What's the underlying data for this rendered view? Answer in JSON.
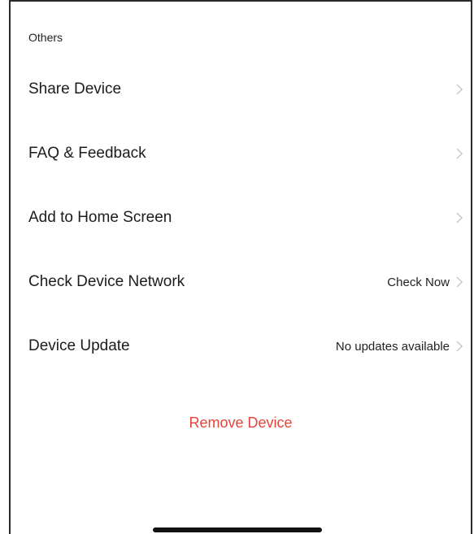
{
  "section": {
    "title": "Others"
  },
  "rows": [
    {
      "label": "Share Device",
      "value": ""
    },
    {
      "label": "FAQ & Feedback",
      "value": ""
    },
    {
      "label": "Add to Home Screen",
      "value": ""
    },
    {
      "label": "Check Device Network",
      "value": "Check Now"
    },
    {
      "label": "Device Update",
      "value": "No updates available"
    }
  ],
  "remove": {
    "label": "Remove Device",
    "color": "#e5443b"
  },
  "icons": {
    "row_chevron": "chevron-right-icon"
  }
}
